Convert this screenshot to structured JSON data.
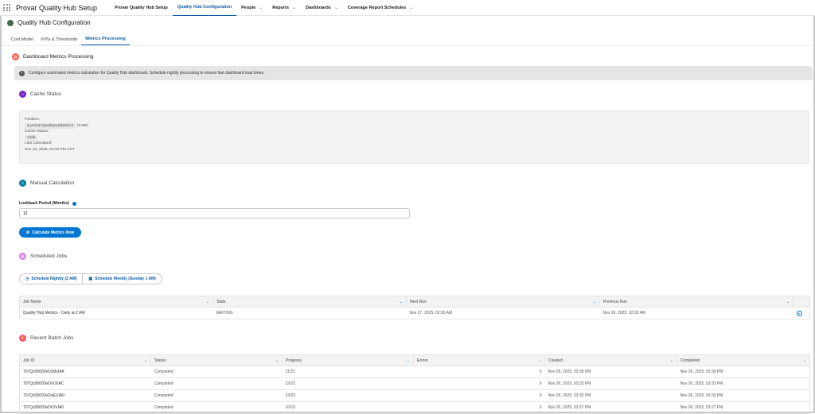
{
  "app": {
    "title": "Provar Quality Hub Setup"
  },
  "nav": [
    {
      "label": "Provar Quality Hub Setup",
      "dropdown": false
    },
    {
      "label": "Quality Hub Configuration",
      "dropdown": false,
      "active": true
    },
    {
      "label": "People",
      "dropdown": true
    },
    {
      "label": "Reports",
      "dropdown": true
    },
    {
      "label": "Dashboards",
      "dropdown": true
    },
    {
      "label": "Coverage Report Schedules",
      "dropdown": true
    }
  ],
  "page": {
    "title": "Quality Hub Configuration"
  },
  "tabs": [
    {
      "label": "Cost Model"
    },
    {
      "label": "KPIs & Thresholds"
    },
    {
      "label": "Metrics Processing",
      "active": true
    }
  ],
  "section": {
    "title": "Dashboard Metrics Processing",
    "info": "Configure automated metrics calculation for Quality Hub dashboard. Schedule nightly processing to ensure fast dashboard load times."
  },
  "cache": {
    "title": "Cache Status",
    "partition_label": "Partition:",
    "partition": "provar.QualityHubMetrics",
    "size": "(3 MB)",
    "status_label": "Cache Status:",
    "status": "Valid",
    "last_label": "Last Calculated:",
    "last": "Nov 26, 2025, 03:33 PM CST"
  },
  "manual": {
    "title": "Manual Calculation",
    "lookback_label": "Lookback Period (Months)",
    "lookback_value": "12",
    "button": "Calculate Metrics Now"
  },
  "scheduled": {
    "title": "Scheduled Jobs",
    "nightly": "Schedule Nightly (2 AM)",
    "weekly": "Schedule Weekly (Sunday 1 AM)",
    "columns": [
      "Job Name",
      "State",
      "Next Run",
      "Previous Run"
    ],
    "rows": [
      [
        "Quality Hub Metrics - Daily at 2 AM",
        "WAITING",
        "Nov 27, 2025, 02:00 AM",
        "Nov 26, 2025, 02:00 AM"
      ]
    ]
  },
  "batch": {
    "title": "Recent Batch Jobs",
    "columns": [
      "Job ID",
      "Status",
      "Progress",
      "Errors",
      "Created",
      "Completed"
    ],
    "rows": [
      [
        "707Qz00000vDzMsIAK",
        "Completed",
        "21/21",
        "0",
        "Nov 26, 2025, 03:39 PM",
        "Nov 26, 2025, 03:39 PM"
      ],
      [
        "707Qz00000vDrXXIAC",
        "Completed",
        "22/22",
        "0",
        "Nov 26, 2025, 03:33 PM",
        "Nov 26, 2025, 03:33 PM"
      ],
      [
        "707Qz00000vDuEUIA0",
        "Completed",
        "23/23",
        "0",
        "Nov 26, 2025, 03:33 PM",
        "Nov 26, 2025, 03:33 PM"
      ],
      [
        "707Qz00000vDrOVIA0",
        "Completed",
        "10/10",
        "0",
        "Nov 26, 2025, 03:27 PM",
        "Nov 26, 2025, 03:27 PM"
      ]
    ]
  },
  "colors": {
    "brand": "#0176d3",
    "active_tab": "#0b5cab"
  }
}
